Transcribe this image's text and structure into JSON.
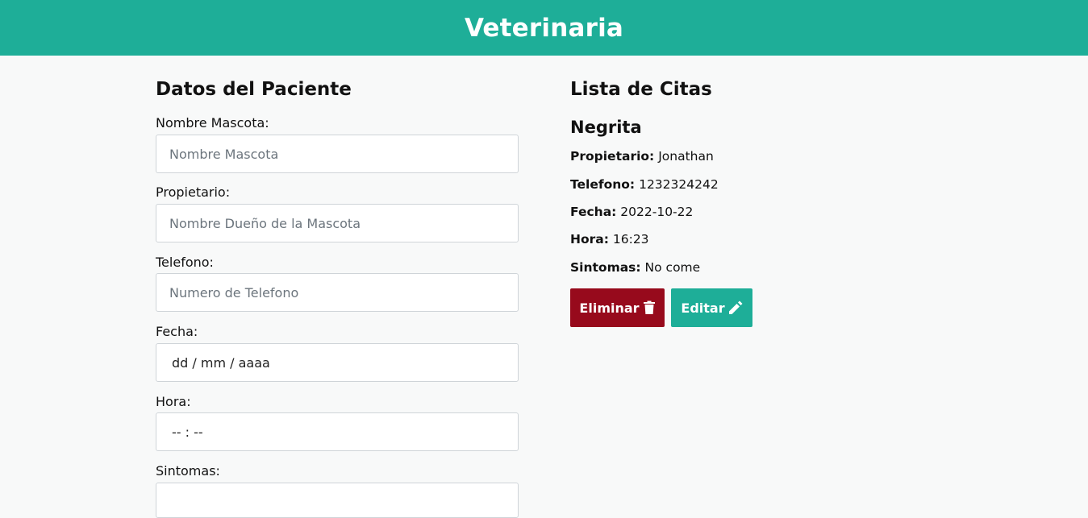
{
  "header": {
    "title": "Veterinaria"
  },
  "form": {
    "title": "Datos del Paciente",
    "fields": {
      "mascota": {
        "label": "Nombre Mascota:",
        "placeholder": "Nombre Mascota"
      },
      "propietario": {
        "label": "Propietario:",
        "placeholder": "Nombre Dueño de la Mascota"
      },
      "telefono": {
        "label": "Telefono:",
        "placeholder": "Numero de Telefono"
      },
      "fecha": {
        "label": "Fecha:",
        "value": "dd / mm / aaaa"
      },
      "hora": {
        "label": "Hora:",
        "value": "-- : --"
      },
      "sintomas": {
        "label": "Sintomas:",
        "value": ""
      }
    }
  },
  "list": {
    "title": "Lista de Citas",
    "appointment": {
      "name": "Negrita",
      "propietario_label": "Propietario:",
      "propietario": "Jonathan",
      "telefono_label": "Telefono:",
      "telefono": "1232324242",
      "fecha_label": "Fecha:",
      "fecha": "2022-10-22",
      "hora_label": "Hora:",
      "hora": "16:23",
      "sintomas_label": "Sintomas:",
      "sintomas": "No come",
      "delete_label": "Eliminar",
      "edit_label": "Editar",
      "delete_icon": "trash-icon",
      "edit_icon": "pencil-icon"
    }
  },
  "colors": {
    "primary": "#1eae98",
    "danger": "#970a1c",
    "background": "#f8f9f9"
  }
}
